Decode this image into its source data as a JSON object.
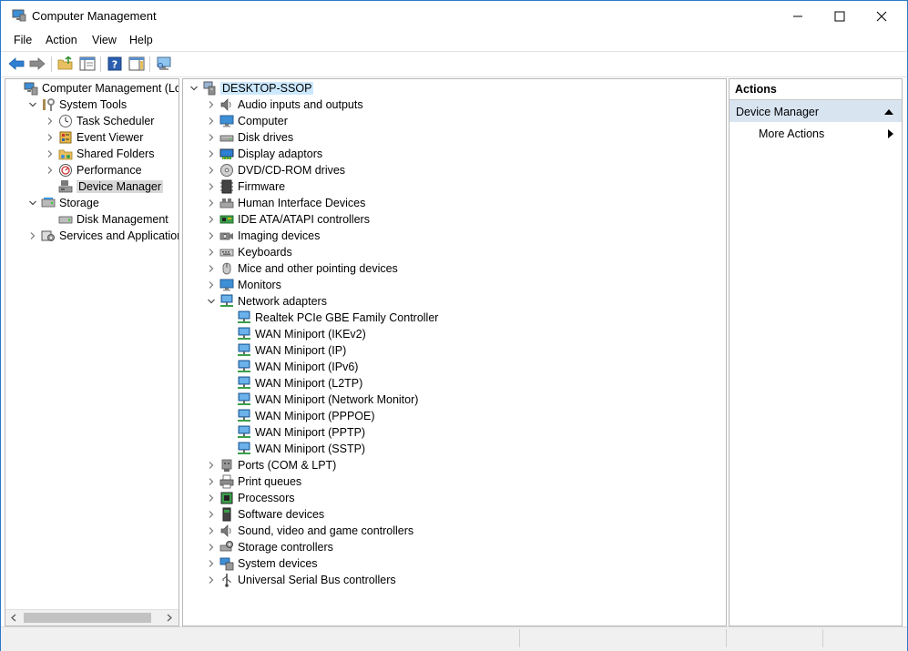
{
  "window": {
    "title": "Computer Management"
  },
  "menu": [
    "File",
    "Action",
    "View",
    "Help"
  ],
  "left_tree": [
    {
      "label": "Computer Management (Local",
      "depth": 0,
      "expander": "none",
      "icon": "computer-management-icon"
    },
    {
      "label": "System Tools",
      "depth": 1,
      "expander": "down",
      "icon": "system-tools-icon"
    },
    {
      "label": "Task Scheduler",
      "depth": 2,
      "expander": "right",
      "icon": "clock-icon"
    },
    {
      "label": "Event Viewer",
      "depth": 2,
      "expander": "right",
      "icon": "event-viewer-icon"
    },
    {
      "label": "Shared Folders",
      "depth": 2,
      "expander": "right",
      "icon": "shared-folders-icon"
    },
    {
      "label": "Performance",
      "depth": 2,
      "expander": "right",
      "icon": "performance-icon"
    },
    {
      "label": "Device Manager",
      "depth": 2,
      "expander": "none",
      "icon": "device-manager-icon",
      "selected": true
    },
    {
      "label": "Storage",
      "depth": 1,
      "expander": "down",
      "icon": "storage-icon"
    },
    {
      "label": "Disk Management",
      "depth": 2,
      "expander": "none",
      "icon": "disk-management-icon"
    },
    {
      "label": "Services and Applications",
      "depth": 1,
      "expander": "right",
      "icon": "services-icon"
    }
  ],
  "device_tree": [
    {
      "label": "DESKTOP-SSOP",
      "depth": 0,
      "expander": "down",
      "icon": "computer-root-icon",
      "selected": true
    },
    {
      "label": "Audio inputs and outputs",
      "depth": 1,
      "expander": "right",
      "icon": "speaker-icon"
    },
    {
      "label": "Computer",
      "depth": 1,
      "expander": "right",
      "icon": "monitor-icon"
    },
    {
      "label": "Disk drives",
      "depth": 1,
      "expander": "right",
      "icon": "disk-drive-icon"
    },
    {
      "label": "Display adaptors",
      "depth": 1,
      "expander": "right",
      "icon": "display-adapter-icon"
    },
    {
      "label": "DVD/CD-ROM drives",
      "depth": 1,
      "expander": "right",
      "icon": "dvd-icon"
    },
    {
      "label": "Firmware",
      "depth": 1,
      "expander": "right",
      "icon": "firmware-icon"
    },
    {
      "label": "Human Interface Devices",
      "depth": 1,
      "expander": "right",
      "icon": "hid-icon"
    },
    {
      "label": "IDE ATA/ATAPI controllers",
      "depth": 1,
      "expander": "right",
      "icon": "ide-icon"
    },
    {
      "label": "Imaging devices",
      "depth": 1,
      "expander": "right",
      "icon": "camera-icon"
    },
    {
      "label": "Keyboards",
      "depth": 1,
      "expander": "right",
      "icon": "keyboard-icon"
    },
    {
      "label": "Mice and other pointing devices",
      "depth": 1,
      "expander": "right",
      "icon": "mouse-icon"
    },
    {
      "label": "Monitors",
      "depth": 1,
      "expander": "right",
      "icon": "monitor-icon"
    },
    {
      "label": "Network adapters",
      "depth": 1,
      "expander": "down",
      "icon": "network-icon"
    },
    {
      "label": "Realtek PCIe GBE Family Controller",
      "depth": 2,
      "expander": "none",
      "icon": "network-icon"
    },
    {
      "label": "WAN Miniport (IKEv2)",
      "depth": 2,
      "expander": "none",
      "icon": "network-icon"
    },
    {
      "label": "WAN Miniport (IP)",
      "depth": 2,
      "expander": "none",
      "icon": "network-icon"
    },
    {
      "label": "WAN Miniport (IPv6)",
      "depth": 2,
      "expander": "none",
      "icon": "network-icon"
    },
    {
      "label": "WAN Miniport (L2TP)",
      "depth": 2,
      "expander": "none",
      "icon": "network-icon"
    },
    {
      "label": "WAN Miniport (Network Monitor)",
      "depth": 2,
      "expander": "none",
      "icon": "network-icon"
    },
    {
      "label": "WAN Miniport (PPPOE)",
      "depth": 2,
      "expander": "none",
      "icon": "network-icon"
    },
    {
      "label": "WAN Miniport (PPTP)",
      "depth": 2,
      "expander": "none",
      "icon": "network-icon"
    },
    {
      "label": "WAN Miniport (SSTP)",
      "depth": 2,
      "expander": "none",
      "icon": "network-icon"
    },
    {
      "label": "Ports (COM & LPT)",
      "depth": 1,
      "expander": "right",
      "icon": "port-icon"
    },
    {
      "label": "Print queues",
      "depth": 1,
      "expander": "right",
      "icon": "printer-icon"
    },
    {
      "label": "Processors",
      "depth": 1,
      "expander": "right",
      "icon": "processor-icon"
    },
    {
      "label": "Software devices",
      "depth": 1,
      "expander": "right",
      "icon": "software-device-icon"
    },
    {
      "label": "Sound, video and game controllers",
      "depth": 1,
      "expander": "right",
      "icon": "speaker-icon"
    },
    {
      "label": "Storage controllers",
      "depth": 1,
      "expander": "right",
      "icon": "storage-controller-icon"
    },
    {
      "label": "System devices",
      "depth": 1,
      "expander": "right",
      "icon": "system-device-icon"
    },
    {
      "label": "Universal Serial Bus controllers",
      "depth": 1,
      "expander": "right",
      "icon": "usb-icon"
    }
  ],
  "actions": {
    "header": "Actions",
    "section": "Device Manager",
    "items": [
      "More Actions"
    ]
  },
  "colors": {
    "accent": "#0078d7",
    "selection": "#cce8ff",
    "section_bg": "#d9e4f1"
  }
}
